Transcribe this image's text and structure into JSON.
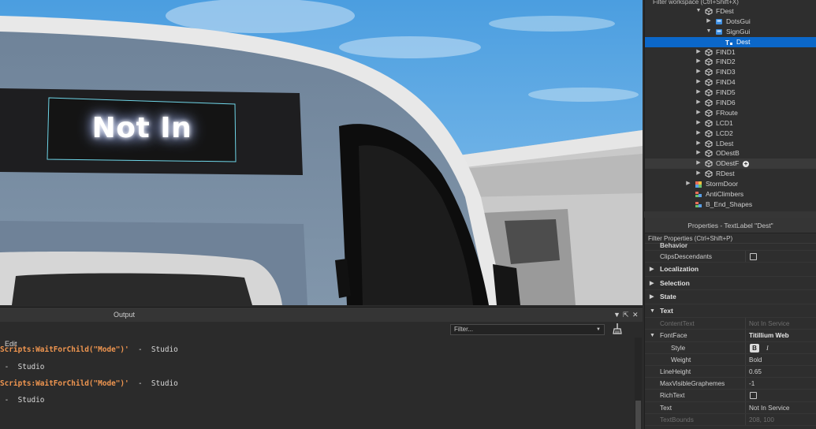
{
  "viewport": {
    "sign_text": "Not In"
  },
  "explorer": {
    "filter_placeholder": "Filter workspace (Ctrl+Shift+X)",
    "items": [
      {
        "label": "FDest",
        "depth": 2,
        "expanded": true,
        "icon": "model-icon"
      },
      {
        "label": "DotsGui",
        "depth": 3,
        "expanded": false,
        "icon": "gui-icon"
      },
      {
        "label": "SignGui",
        "depth": 3,
        "expanded": true,
        "icon": "gui-icon"
      },
      {
        "label": "Dest",
        "depth": 4,
        "expanded": null,
        "icon": "textlabel-icon",
        "selected": true
      },
      {
        "label": "FIND1",
        "depth": 2,
        "expanded": false,
        "icon": "model-icon"
      },
      {
        "label": "FIND2",
        "depth": 2,
        "expanded": false,
        "icon": "model-icon"
      },
      {
        "label": "FIND3",
        "depth": 2,
        "expanded": false,
        "icon": "model-icon"
      },
      {
        "label": "FIND4",
        "depth": 2,
        "expanded": false,
        "icon": "model-icon"
      },
      {
        "label": "FIND5",
        "depth": 2,
        "expanded": false,
        "icon": "model-icon"
      },
      {
        "label": "FIND6",
        "depth": 2,
        "expanded": false,
        "icon": "model-icon"
      },
      {
        "label": "FRoute",
        "depth": 2,
        "expanded": false,
        "icon": "model-icon"
      },
      {
        "label": "LCD1",
        "depth": 2,
        "expanded": false,
        "icon": "model-icon"
      },
      {
        "label": "LCD2",
        "depth": 2,
        "expanded": false,
        "icon": "model-icon"
      },
      {
        "label": "LDest",
        "depth": 2,
        "expanded": false,
        "icon": "model-icon"
      },
      {
        "label": "ODestB",
        "depth": 2,
        "expanded": false,
        "icon": "model-icon"
      },
      {
        "label": "ODestF",
        "depth": 2,
        "expanded": false,
        "icon": "model-icon",
        "hover": true
      },
      {
        "label": "RDest",
        "depth": 2,
        "expanded": false,
        "icon": "model-icon"
      },
      {
        "label": "StormDoor",
        "depth": 1,
        "expanded": false,
        "icon": "union-icon"
      },
      {
        "label": "AntiClimbers",
        "depth": 1,
        "expanded": null,
        "icon": "parts-icon"
      },
      {
        "label": "B_End_Shapes",
        "depth": 1,
        "expanded": null,
        "icon": "parts-icon"
      }
    ]
  },
  "properties": {
    "title": "Properties - TextLabel \"Dest\"",
    "filter_placeholder": "Filter Properties (Ctrl+Shift+P)",
    "behavior_label": "Behavior",
    "clips_descendants_label": "ClipsDescendants",
    "sections": {
      "localization": "Localization",
      "selection": "Selection",
      "state": "State",
      "text": "Text"
    },
    "content_text": {
      "name": "ContentText",
      "value": "Not In Service"
    },
    "font_face": {
      "name": "FontFace",
      "value": "Titillium Web"
    },
    "style": {
      "name": "Style",
      "bold": "B",
      "italic": "I"
    },
    "weight": {
      "name": "Weight",
      "value": "Bold"
    },
    "line_height": {
      "name": "LineHeight",
      "value": "0.65"
    },
    "max_visible_graphemes": {
      "name": "MaxVisibleGraphemes",
      "value": "-1"
    },
    "rich_text": {
      "name": "RichText"
    },
    "text": {
      "name": "Text",
      "value": "Not In Service"
    },
    "text_bounds": {
      "name": "TextBounds",
      "value": "208, 100"
    }
  },
  "output": {
    "title": "Output",
    "filter_placeholder": "Filter...",
    "edit_label": "Edit",
    "lines": [
      {
        "code": "Scripts:WaitForChild(\"Mode\")'",
        "suffix": "  -  Studio"
      },
      {
        "code": "",
        "suffix": " -  Studio"
      },
      {
        "code": "Scripts:WaitForChild(\"Mode\")'",
        "suffix": "  -  Studio"
      },
      {
        "code": "",
        "suffix": " -  Studio"
      }
    ]
  }
}
